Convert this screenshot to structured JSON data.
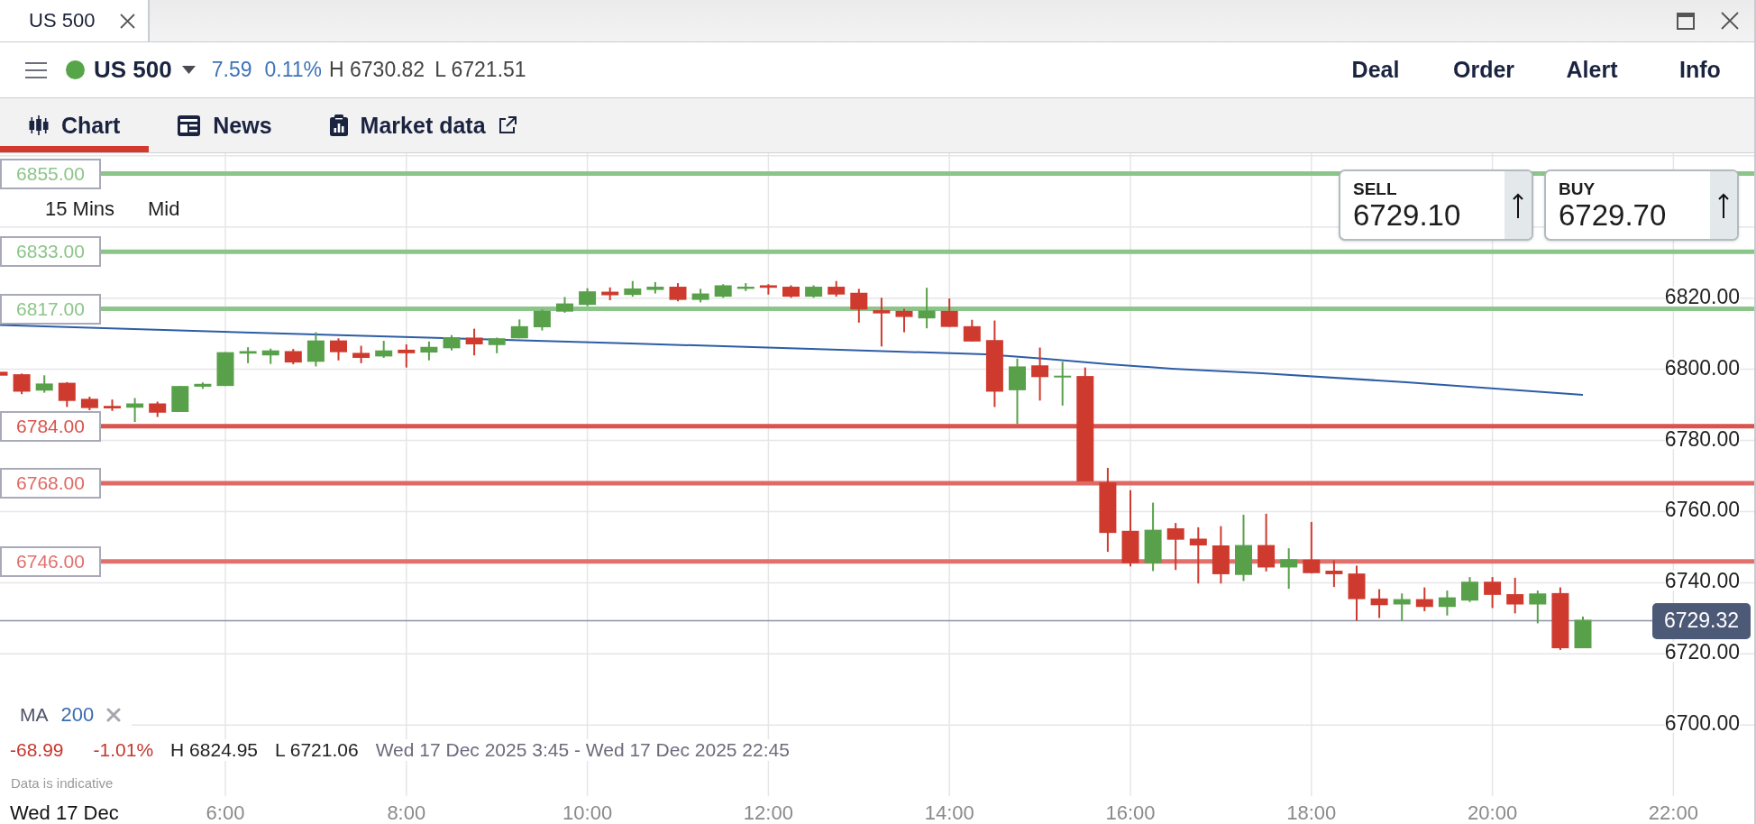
{
  "window": {
    "tab": "US 500"
  },
  "instrument": {
    "name": "US 500",
    "change": "7.59",
    "change_percent": "0.11%",
    "high": "H 6730.82",
    "low": "L 6721.51"
  },
  "actions": [
    "Deal",
    "Order",
    "Alert",
    "Info"
  ],
  "tabs": [
    {
      "kind": "chart",
      "label": "Chart",
      "selected": true,
      "external": false
    },
    {
      "kind": "news",
      "label": "News",
      "selected": false,
      "external": false
    },
    {
      "kind": "market_data",
      "label": "Market data",
      "selected": false,
      "external": true
    }
  ],
  "chart": {
    "interval": "15 Mins",
    "price_type": "Mid",
    "tickets": [
      {
        "label": "SELL",
        "price": "6729.10"
      },
      {
        "label": "BUY",
        "price": "6729.70"
      }
    ],
    "levels": [
      {
        "price": "6855.00",
        "color": "#8cc589"
      },
      {
        "price": "6833.00",
        "color": "#8cc589"
      },
      {
        "price": "6817.00",
        "color": "#8cc589"
      },
      {
        "price": "6784.00",
        "color": "#d9544e"
      },
      {
        "price": "6768.00",
        "color": "#df6964"
      },
      {
        "price": "6746.00",
        "color": "#e0716d"
      }
    ],
    "price_axis": [
      "6820.00",
      "6800.00",
      "6780.00",
      "6760.00",
      "6740.00",
      "6720.00",
      "6700.00"
    ],
    "current_price": "6729.32",
    "indicator": {
      "name": "MA",
      "period": "200"
    },
    "summary": {
      "change": "-68.99",
      "change_percent": "-1.01%",
      "high": "H 6824.95",
      "low": "L 6721.06",
      "range": "Wed 17 Dec 2025 3:45 - Wed 17 Dec 2025 22:45"
    },
    "notice": "Data is indicative",
    "date": "Wed 17 Dec",
    "time_axis": [
      "6:00",
      "8:00",
      "10:00",
      "12:00",
      "14:00",
      "16:00",
      "18:00",
      "20:00",
      "22:00"
    ]
  }
}
